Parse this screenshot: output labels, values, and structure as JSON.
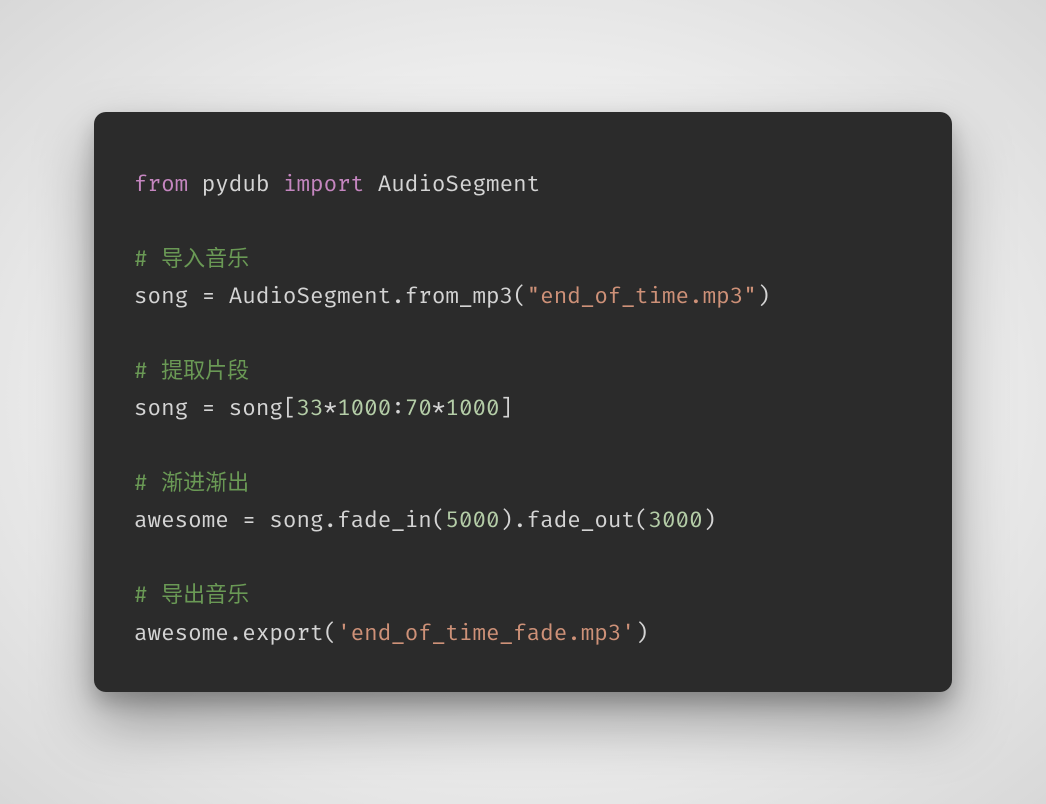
{
  "code": {
    "line1": {
      "kw_from": "from",
      "module": "pydub",
      "kw_import": "import",
      "cls": "AudioSegment"
    },
    "cmt1": "# 导入音乐",
    "line3": {
      "lhs": "song = AudioSegment.from_mp3(",
      "str": "\"end_of_time.mp3\"",
      "rhs": ")"
    },
    "cmt2": "# 提取片段",
    "line5": {
      "a": "song = song[",
      "n1": "33",
      "op1": "*",
      "n2": "1000",
      "colon": ":",
      "n3": "70",
      "op2": "*",
      "n4": "1000",
      "b": "]"
    },
    "cmt3": "# 渐进渐出",
    "line7": {
      "a": "awesome = song.fade_in(",
      "n1": "5000",
      "b": ").fade_out(",
      "n2": "3000",
      "c": ")"
    },
    "cmt4": "# 导出音乐",
    "line9": {
      "a": "awesome.export(",
      "str": "'end_of_time_fade.mp3'",
      "b": ")"
    }
  }
}
